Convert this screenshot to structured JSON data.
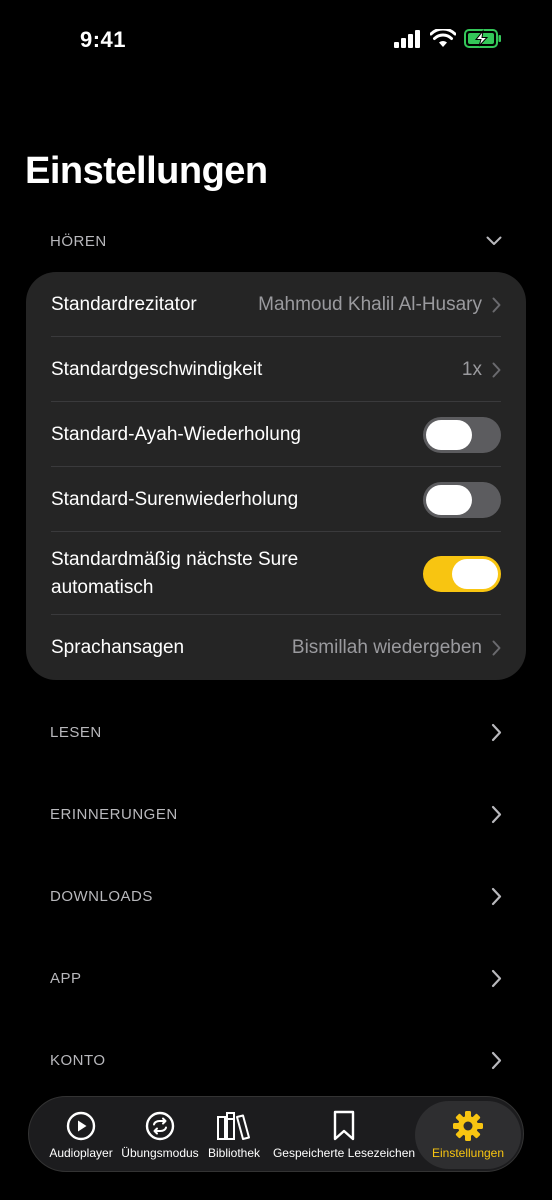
{
  "status_bar": {
    "time": "9:41"
  },
  "page": {
    "title": "Einstellungen"
  },
  "hoeren": {
    "label": "HÖREN",
    "rows": [
      {
        "label": "Standardrezitator",
        "value": "Mahmoud Khalil Al-Husary"
      },
      {
        "label": "Standardgeschwindigkeit",
        "value": "1x"
      },
      {
        "label": "Standard-Ayah-Wiederholung",
        "toggle": false
      },
      {
        "label": "Standard-Surenwiederholung",
        "toggle": false
      },
      {
        "label": "Standardmäßig nächste Sure automatisch",
        "toggle": true
      },
      {
        "label": "Sprachansagen",
        "value": "Bismillah wiedergeben"
      }
    ]
  },
  "sections": [
    {
      "label": "LESEN"
    },
    {
      "label": "ERINNERUNGEN"
    },
    {
      "label": "DOWNLOADS"
    },
    {
      "label": "APP"
    },
    {
      "label": "KONTO"
    }
  ],
  "tab_bar": {
    "tabs": [
      {
        "label": "Audioplayer",
        "icon": "play-circle-icon"
      },
      {
        "label": "Übungsmodus",
        "icon": "repeat-circle-icon"
      },
      {
        "label": "Bibliothek",
        "icon": "books-icon"
      },
      {
        "label": "Gespeicherte Lesezeichen",
        "icon": "bookmark-icon"
      },
      {
        "label": "Einstellungen",
        "icon": "gear-icon",
        "active": true
      }
    ]
  },
  "colors": {
    "accent": "#f8c511",
    "card": "#252525",
    "background": "#000000"
  }
}
